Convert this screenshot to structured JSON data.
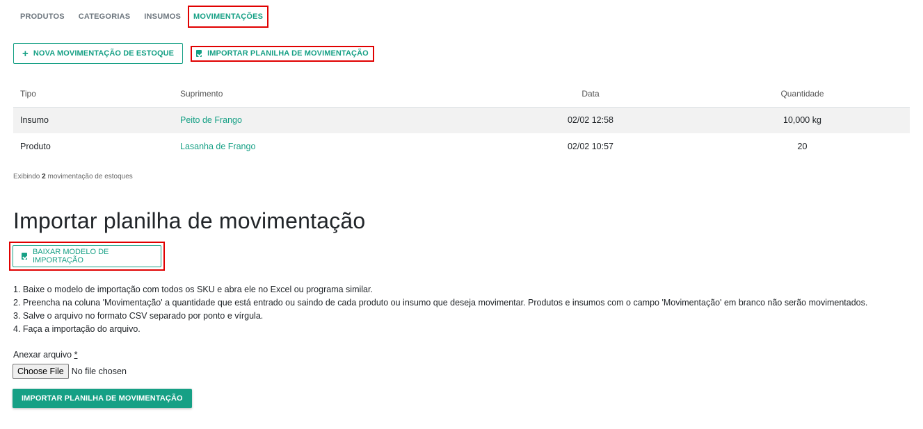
{
  "tabs": [
    {
      "label": "PRODUTOS",
      "active": false
    },
    {
      "label": "CATEGORIAS",
      "active": false
    },
    {
      "label": "INSUMOS",
      "active": false
    },
    {
      "label": "MOVIMENTAÇÕES",
      "active": true
    }
  ],
  "actions": {
    "new_movement": "NOVA MOVIMENTAÇÃO DE ESTOQUE",
    "import_sheet": "IMPORTAR PLANILHA DE MOVIMENTAÇÃO"
  },
  "table": {
    "headers": {
      "type": "Tipo",
      "supply": "Suprimento",
      "date": "Data",
      "quantity": "Quantidade"
    },
    "rows": [
      {
        "type": "Insumo",
        "supply": "Peito de Frango",
        "date": "02/02 12:58",
        "quantity": "10,000 kg"
      },
      {
        "type": "Produto",
        "supply": "Lasanha de Frango",
        "date": "02/02 10:57",
        "quantity": "20"
      }
    ]
  },
  "count": {
    "prefix": "Exibindo",
    "number": "2",
    "suffix": "movimentação de estoques"
  },
  "import": {
    "title": "Importar planilha de movimentação",
    "download_button": "BAIXAR MODELO DE IMPORTAÇÃO",
    "steps": [
      "1. Baixe o modelo de importação com todos os SKU e abra ele no Excel ou programa similar.",
      "2. Preencha na coluna 'Movimentação' a quantidade que está entrado ou saindo de cada produto ou insumo que deseja movimentar. Produtos e insumos com o campo 'Movimentação' em branco não serão movimentados.",
      "3. Salve o arquivo no formato CSV separado por ponto e vírgula.",
      "4. Faça a importação do arquivo."
    ],
    "attach_label": "Anexar arquivo",
    "required_mark": "*",
    "choose_file": "Choose File",
    "no_file": "No file chosen",
    "submit": "IMPORTAR PLANILHA DE MOVIMENTAÇÃO"
  },
  "colors": {
    "accent": "#16a085",
    "highlight": "#e00000"
  },
  "icons": {
    "plus": "plus-icon",
    "document": "document-icon"
  }
}
